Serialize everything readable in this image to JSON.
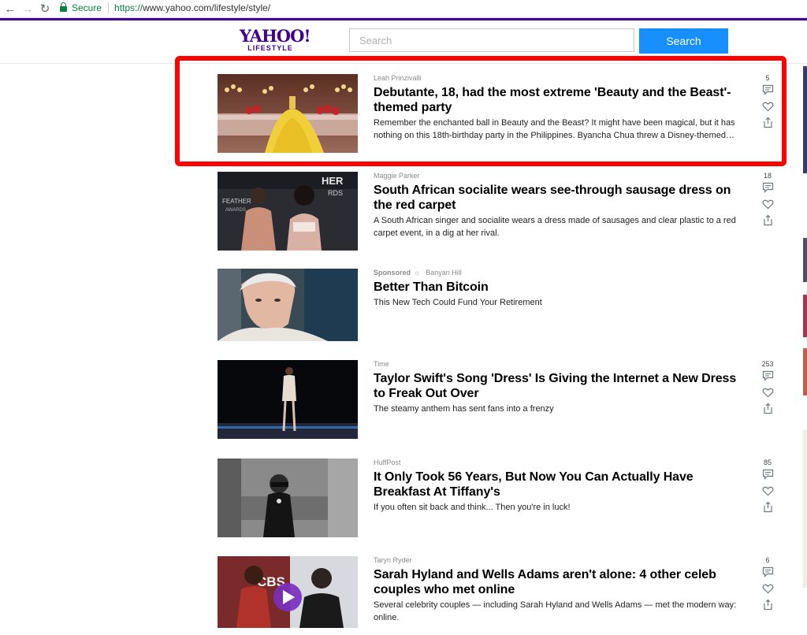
{
  "browser": {
    "back_icon": "back-arrow-icon",
    "forward_icon": "forward-arrow-icon",
    "reload_icon": "reload-icon",
    "secure_label": "Secure",
    "url_scheme": "https://",
    "url_rest": "www.yahoo.com/lifestyle/style/"
  },
  "header": {
    "logo_main": "YAHOO!",
    "logo_sub": "LIFESTYLE",
    "search_placeholder": "Search",
    "search_button": "Search",
    "accent_color": "#400090",
    "button_color": "#188fff"
  },
  "stories": [
    {
      "provider": "Leah Prinzivalli",
      "title": "Debutante, 18, had the most extreme 'Beauty and the Beast'-themed party",
      "summary": "Remember the enchanted ball in Beauty and the Beast? It might have been magical, but it has nothing on this 18th-birthday party in the Philippines. Byancha Chua threw a Disney-themed…",
      "comments": "5"
    },
    {
      "provider": "Maggie Parker",
      "title": "South African socialite wears see-through sausage dress on the red carpet",
      "summary": "A South African singer and socialite wears a dress made of sausages and clear plastic to a red carpet event, in a dig at her rival.",
      "comments": "18"
    },
    {
      "sponsored_label": "Sponsored",
      "provider": "Banyan Hill",
      "title": "Better Than Bitcoin",
      "summary": "This New Tech Could Fund Your Retirement"
    },
    {
      "provider": "Time",
      "title": "Taylor Swift's Song 'Dress' Is Giving the Internet a New Dress to Freak Out Over",
      "summary": "The steamy anthem has sent fans into a frenzy",
      "comments": "253"
    },
    {
      "provider": "HuffPost",
      "title": "It Only Took 56 Years, But Now You Can Actually Have Breakfast At Tiffany's",
      "summary": "If you often sit back and think... Then you're in luck!",
      "comments": "85"
    },
    {
      "provider": "Taryn Ryder",
      "title": "Sarah Hyland and Wells Adams aren't alone: 4 other celeb couples who met online",
      "summary": "Several celebrity couples — including Sarah Hyland and Wells Adams — met the modern way: online.",
      "comments": "6",
      "thumb_text": "CBS"
    }
  ],
  "annotation": {
    "color": "#ff0000",
    "target": "story 1"
  }
}
